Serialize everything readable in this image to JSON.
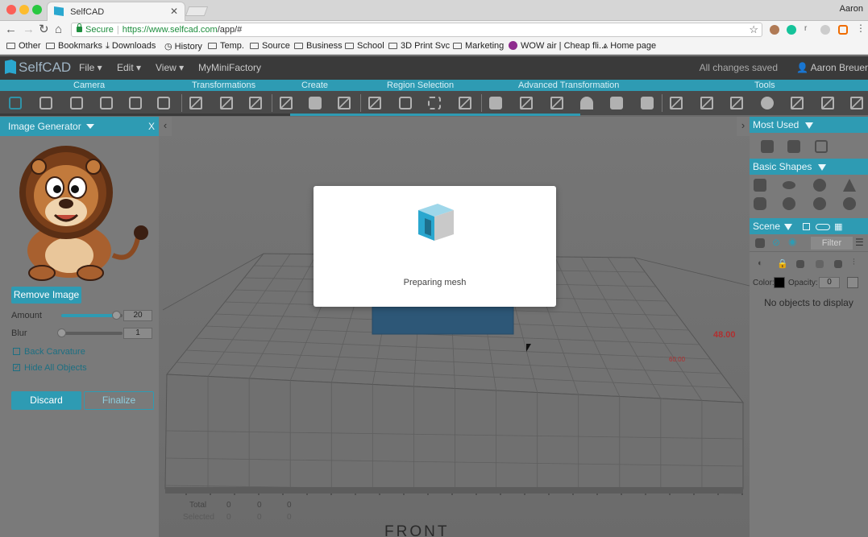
{
  "browser": {
    "tab_title": "SelfCAD",
    "profile_name": "Aaron",
    "url_secure_label": "Secure",
    "url_host": "https://www.selfcad.com",
    "url_path": "/app/#",
    "bookmarks": [
      "Other",
      "Bookmarks",
      "Downloads",
      "History",
      "Temp.",
      "Source",
      "Business",
      "School",
      "3D Print Svc",
      "Marketing",
      "WOW air | Cheap fli...",
      "Home page"
    ]
  },
  "app": {
    "logo_text": "SelfCAD",
    "menus": [
      "File",
      "Edit",
      "View",
      "MyMiniFactory"
    ],
    "save_status": "All changes saved",
    "user_name": "Aaron Breuer",
    "groups": [
      "Camera",
      "Transformations",
      "Create",
      "Region Selection",
      "Advanced Transformation",
      "Tools"
    ]
  },
  "left_panel": {
    "title": "Image Generator",
    "remove_image_label": "Remove Image",
    "amount_label": "Amount",
    "amount_value": "20",
    "amount_fraction": 0.9,
    "blur_label": "Blur",
    "blur_value": "1",
    "blur_fraction": 0.0,
    "back_carvature_label": "Back Carvature",
    "back_carvature_checked": false,
    "hide_all_label": "Hide All Objects",
    "hide_all_checked": true,
    "discard_label": "Discard",
    "finalize_label": "Finalize"
  },
  "viewport": {
    "stats": {
      "total_label": "Total",
      "selected_label": "Selected",
      "total_values": [
        "0",
        "0",
        "0"
      ],
      "selected_values": [
        "0",
        "0",
        "0"
      ]
    },
    "front_label": "FRONT",
    "ruler_a": "48.00",
    "ruler_b": "60.00"
  },
  "modal": {
    "message": "Preparing mesh"
  },
  "right_panel": {
    "most_used_title": "Most Used",
    "basic_shapes_title": "Basic Shapes",
    "scene_title": "Scene",
    "filter_label": "Filter",
    "color_label": "Color:",
    "opacity_label": "Opacity:",
    "opacity_value": "0",
    "empty_message": "No objects to display"
  },
  "colors": {
    "accent": "#2e9bb3",
    "app_dark": "#3a3a3a",
    "panel_bg": "#7a7a7a"
  }
}
